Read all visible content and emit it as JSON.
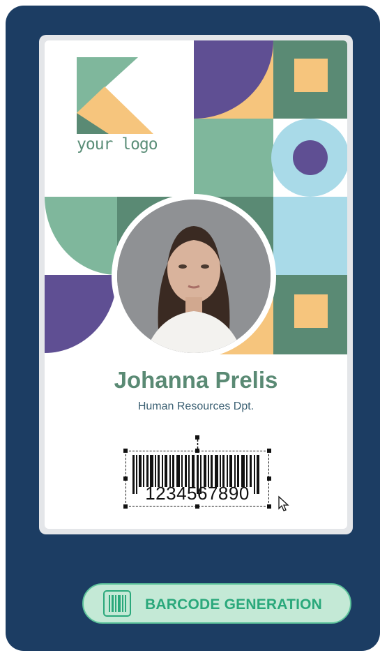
{
  "card": {
    "logo_text": "your logo",
    "name": "Johanna Prelis",
    "department": "Human Resources Dpt.",
    "barcode_number": "1234567890"
  },
  "badge": {
    "label": "BARCODE GENERATION",
    "icon": "barcode-icon"
  },
  "colors": {
    "background": "#1c3d63",
    "accent_green": "#5a8a74",
    "mint": "#7fb79c",
    "purple": "#5f4f93",
    "peach": "#f6c57d",
    "light_blue": "#a9dae8",
    "badge_text": "#2aa87b",
    "badge_fill": "#c4e9d6"
  }
}
